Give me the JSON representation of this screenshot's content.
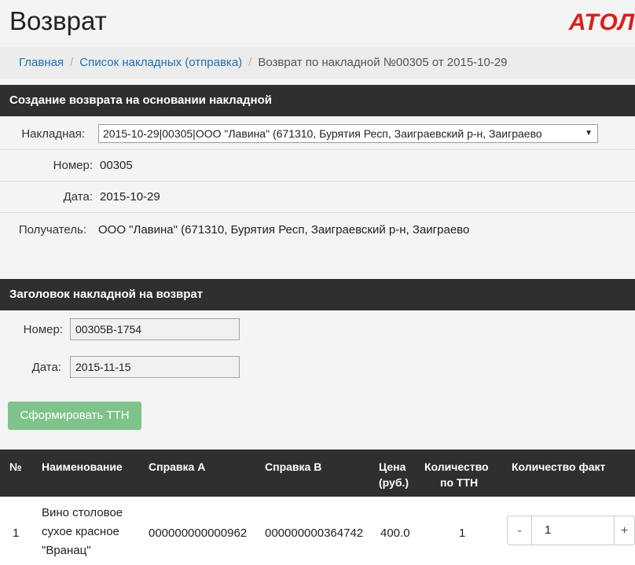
{
  "header": {
    "title": "Возврат",
    "logo": "АТОЛ"
  },
  "breadcrumb": {
    "home": "Главная",
    "list": "Список накладных (отправка)",
    "current": "Возврат по накладной №00305 от 2015-10-29",
    "separator": "/"
  },
  "source_panel": {
    "heading": "Создание возврата на основании накладной",
    "invoice_label": "Накладная:",
    "invoice_value": "2015-10-29|00305|ООО \"Лавина\" (671310, Бурятия Респ, Заиграевский р-н, Заиграево",
    "number_label": "Номер:",
    "number_value": "00305",
    "date_label": "Дата:",
    "date_value": "2015-10-29",
    "recipient_label": "Получатель:",
    "recipient_value": "ООО \"Лавина\" (671310, Бурятия Респ, Заиграевский р-н, Заиграево"
  },
  "return_panel": {
    "heading": "Заголовок накладной на возврат",
    "number_label": "Номер:",
    "number_value": "00305В-1754",
    "date_label": "Дата:",
    "date_value": "2015-11-15"
  },
  "form_button": "Сформировать ТТН",
  "table": {
    "columns": {
      "num": "№",
      "name": "Наименование",
      "ref_a": "Справка А",
      "ref_b": "Справка В",
      "price_1": "Цена",
      "price_2": "(руб.)",
      "qty_1": "Количество",
      "qty_2": "по ТТН",
      "qty_fact": "Количество факт"
    },
    "rows": [
      {
        "num": "1",
        "name_1": "Вино столовое",
        "name_2": "сухое красное",
        "name_3": "\"Вранац\"",
        "ref_a": "000000000000962",
        "ref_b": "000000000364742",
        "price": "400.0",
        "qty": "1",
        "qty_fact": "1",
        "minus": "-",
        "plus": "+"
      }
    ]
  },
  "colors": {
    "accent": "#1f6fb5",
    "logo": "#d8201c",
    "dark_header": "#2f2f2f",
    "button": "#7ec38a"
  }
}
